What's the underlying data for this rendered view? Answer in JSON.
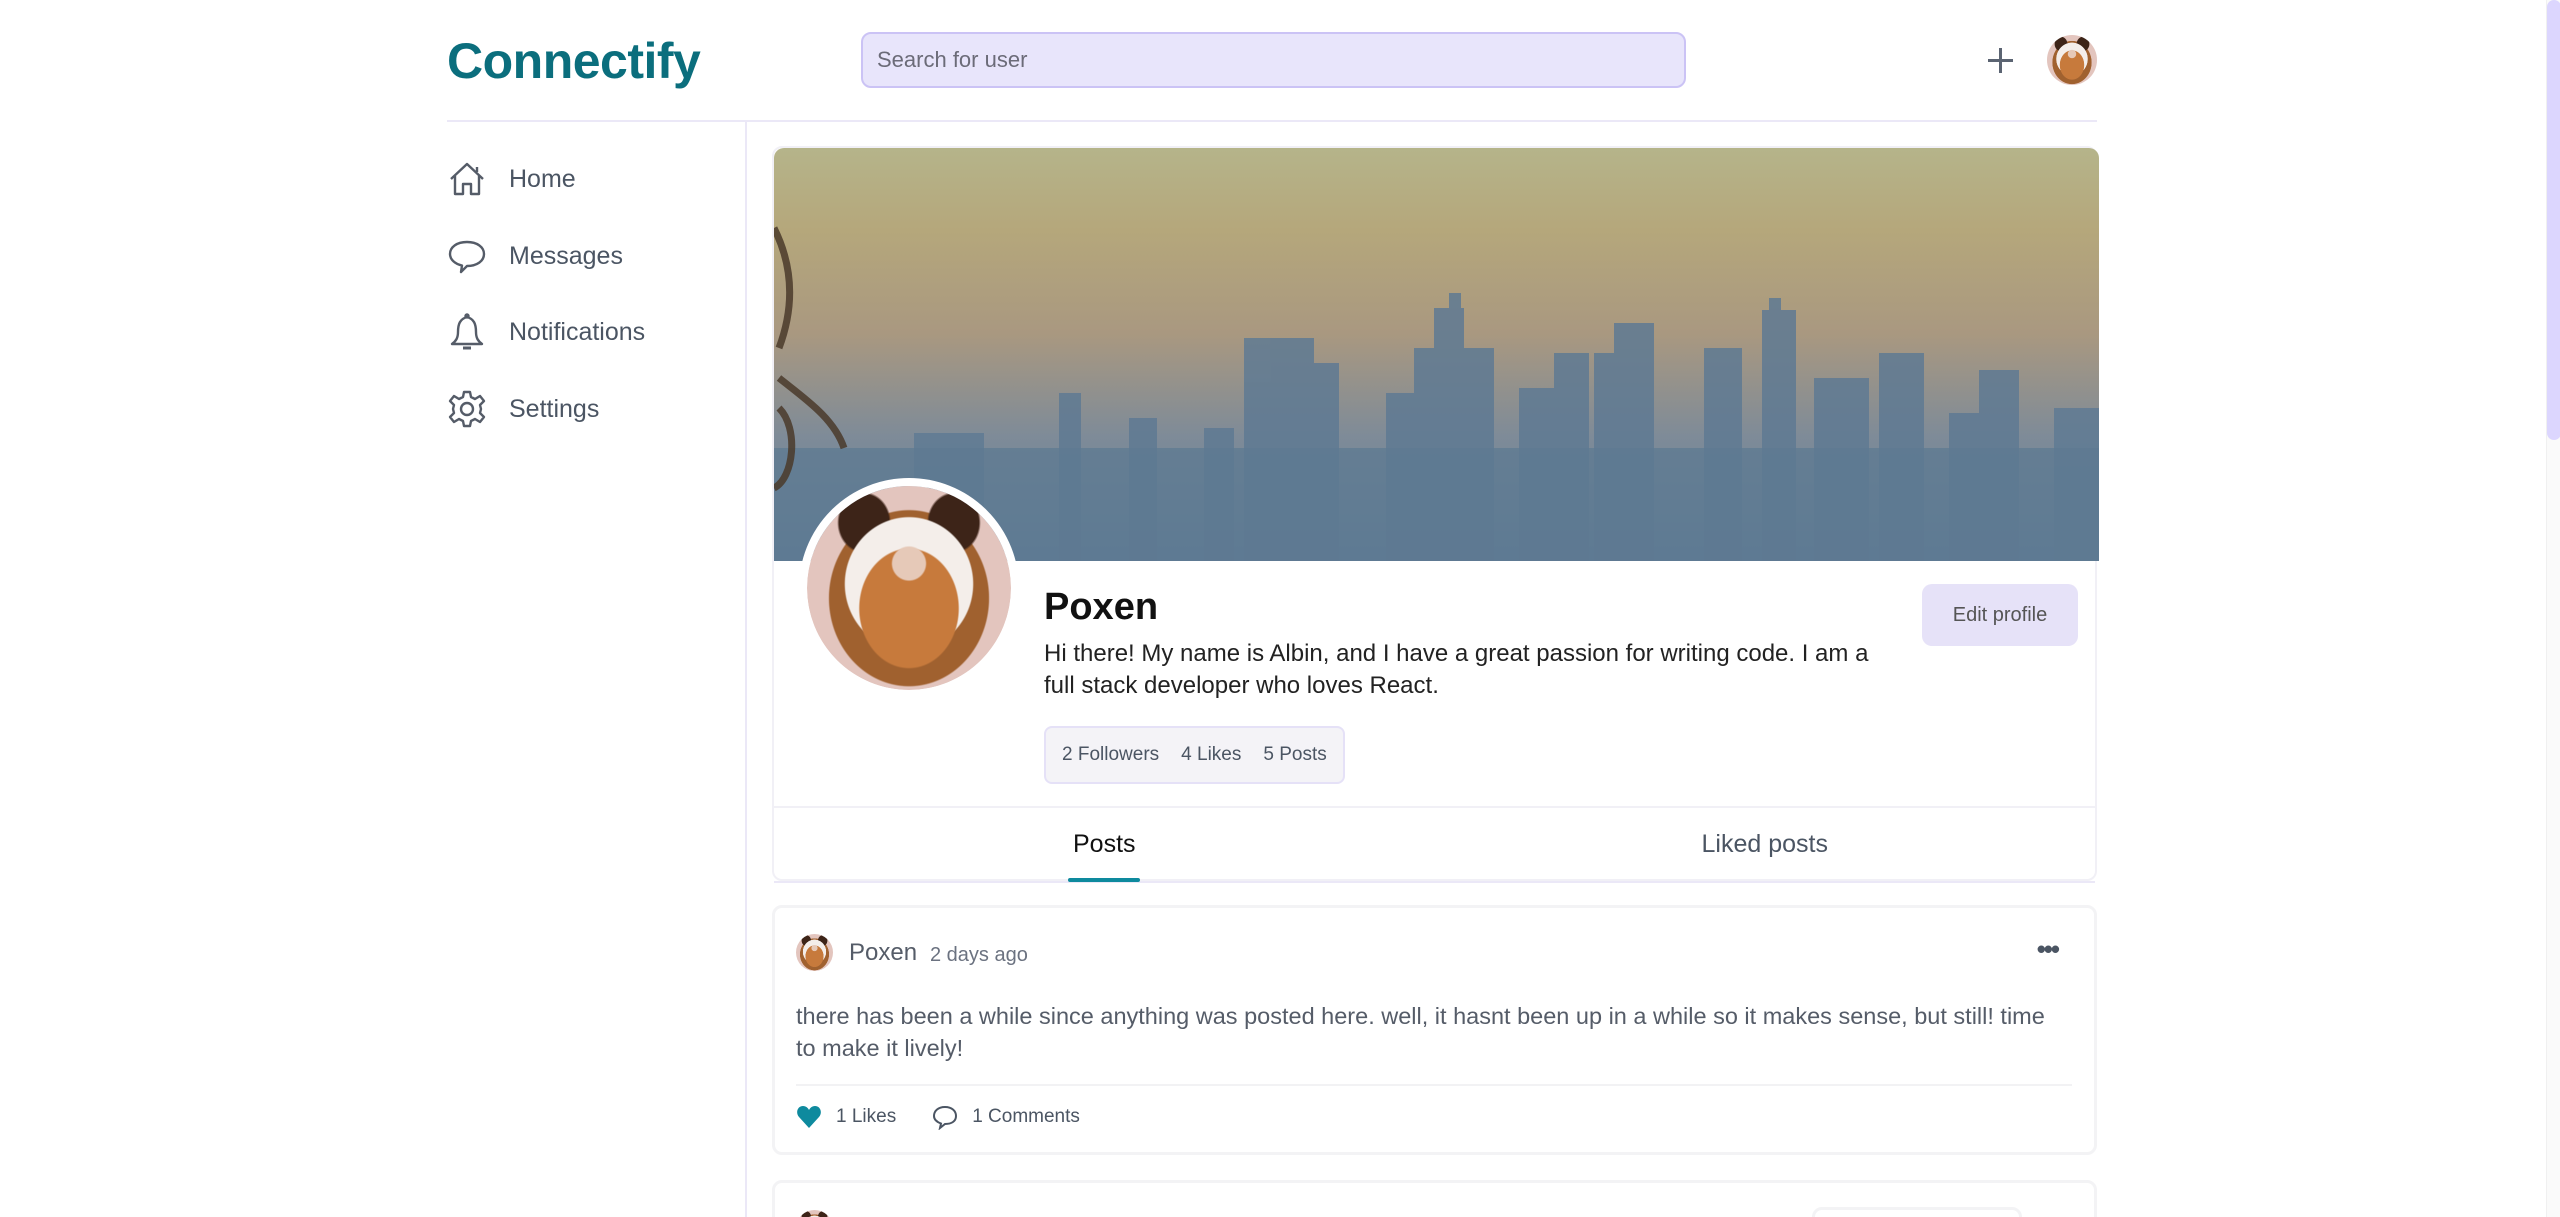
{
  "app": {
    "name": "Connectify"
  },
  "header": {
    "search_placeholder": "Search for user",
    "add_icon": "plus-icon",
    "user_avatar": "cat-avatar"
  },
  "sidebar": {
    "items": [
      {
        "label": "Home",
        "icon": "home-icon"
      },
      {
        "label": "Messages",
        "icon": "chat-bubble-icon"
      },
      {
        "label": "Notifications",
        "icon": "bell-icon"
      },
      {
        "label": "Settings",
        "icon": "gear-icon"
      }
    ]
  },
  "profile": {
    "name": "Poxen",
    "bio": "Hi there! My name is Albin, and I have a great passion for writing code. I am a full stack developer who loves React.",
    "stats": {
      "followers": "2 Followers",
      "likes": "4 Likes",
      "posts": "5 Posts"
    },
    "edit_button": "Edit profile"
  },
  "tabs": [
    {
      "label": "Posts",
      "active": true
    },
    {
      "label": "Liked posts",
      "active": false
    }
  ],
  "posts": [
    {
      "author": "Poxen",
      "time": "2 days ago",
      "text": "there has been a while since anything was posted here. well, it hasnt been up in a while so it makes sense, but still! time to make it lively!",
      "likes": "1 Likes",
      "comments": "1 Comments",
      "liked": true
    }
  ],
  "colors": {
    "brand": "#0b6e7d",
    "accent": "#0e8a9e",
    "search_bg": "#e8e5fb",
    "button_bg": "#e6e2f8",
    "scroll_thumb": "#dcd6fe"
  }
}
